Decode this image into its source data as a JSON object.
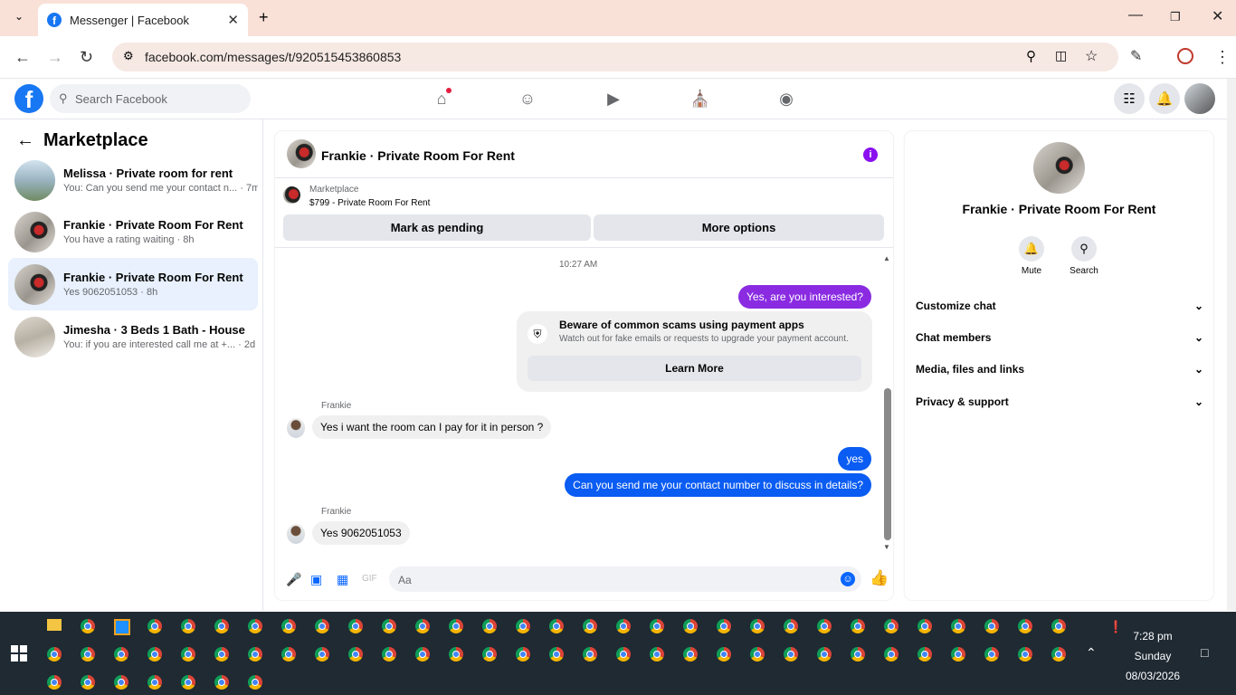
{
  "browser": {
    "tab_title": "Messenger | Facebook",
    "url": "facebook.com/messages/t/920515453860853"
  },
  "fb": {
    "search_placeholder": "Search Facebook"
  },
  "sidebar": {
    "title": "Marketplace",
    "conversations": [
      {
        "name": "Melissa · Private room for rent",
        "preview": "You: Can you send me your contact n... · 7m"
      },
      {
        "name": "Frankie · Private Room For Rent",
        "preview": "You have a rating waiting · 8h"
      },
      {
        "name": "Frankie · Private Room For Rent",
        "preview": "Yes 9062051053 · 8h"
      },
      {
        "name": "Jimesha · 3 Beds 1 Bath - House",
        "preview": "You: if you are interested call me at +... · 2d"
      }
    ]
  },
  "chat": {
    "title": "Frankie · Private Room For Rent",
    "marketplace_label": "Marketplace",
    "listing": "$799 - Private Room For Rent",
    "mark_pending": "Mark as pending",
    "more_options": "More options",
    "timestamp": "10:27 AM",
    "messages": [
      {
        "from": "me",
        "text": "Yes, are you interested?"
      },
      {
        "from": "them",
        "sender": "Frankie",
        "text": "Yes i want the room can I pay for it in person ?"
      },
      {
        "from": "me",
        "text": "yes"
      },
      {
        "from": "me",
        "text": "Can you send me your contact number to discuss in details?"
      },
      {
        "from": "them",
        "sender": "Frankie",
        "text": "Yes 9062051053"
      }
    ],
    "warning_title": "Beware of common scams using payment apps",
    "warning_sub": "Watch out for fake emails or requests to upgrade your payment account.",
    "learn_more": "Learn More",
    "input_placeholder": "Aa"
  },
  "right_panel": {
    "name": "Frankie · Private Room For Rent",
    "mute": "Mute",
    "search": "Search",
    "sections": [
      "Customize chat",
      "Chat members",
      "Media, files and links",
      "Privacy & support"
    ]
  },
  "taskbar": {
    "time": "7:28 pm",
    "day": "Sunday",
    "date": "08/03/2026"
  },
  "colors": {
    "accent": "#0a5cf2",
    "purple": "#8a10f0",
    "fb_blue": "#1877f2"
  }
}
